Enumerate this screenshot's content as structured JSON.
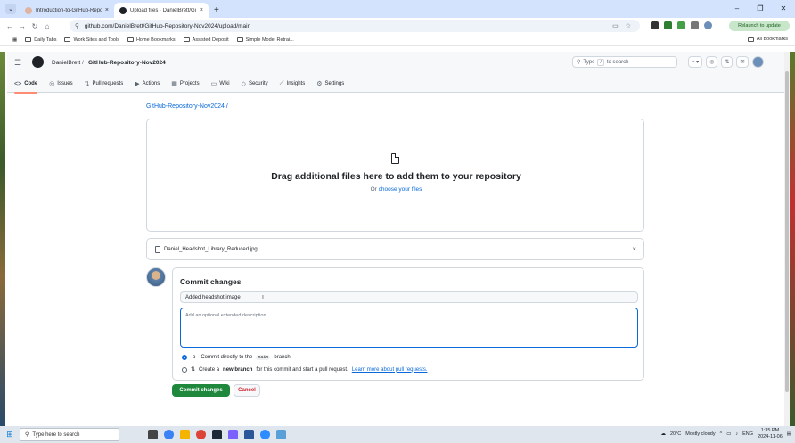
{
  "browser": {
    "tabs": [
      {
        "title": "Introduction-to-GitHub-Reposi"
      },
      {
        "title": "Upload files · DanielBrett/GitH"
      }
    ],
    "address": "github.com/DanielBrett/GitHub-Repository-Nov2024/upload/main",
    "relaunch_label": "Relaunch to update",
    "bookmarks": [
      "Daily Tabs",
      "Work Sites and Tools",
      "Home Bookmarks",
      "Assisted Deposit",
      "Simple Model Retrai..."
    ],
    "all_bookmarks": "All Bookmarks"
  },
  "github": {
    "owner": "DanielBrett",
    "separator": "/",
    "repo": "GitHub-Repository-Nov2024",
    "search_placeholder": "Type",
    "search_key": "/",
    "search_suffix": "to search",
    "plus_label": "+",
    "nav": [
      {
        "label": "Code",
        "icon": "<>"
      },
      {
        "label": "Issues",
        "icon": "◎"
      },
      {
        "label": "Pull requests",
        "icon": "⇅"
      },
      {
        "label": "Actions",
        "icon": "▶"
      },
      {
        "label": "Projects",
        "icon": "▦"
      },
      {
        "label": "Wiki",
        "icon": "▭"
      },
      {
        "label": "Security",
        "icon": "◇"
      },
      {
        "label": "Insights",
        "icon": "⟋"
      },
      {
        "label": "Settings",
        "icon": "⚙"
      }
    ]
  },
  "upload": {
    "repo_crumb": "GitHub-Repository-Nov2024 /",
    "drag_title": "Drag additional files here to add them to your repository",
    "drag_or": "Or",
    "choose_files": "choose your files",
    "file_name": "Daniel_Headshot_Library_Reduced.jpg",
    "remove_icon": "×"
  },
  "commit": {
    "title": "Commit changes",
    "summary_value": "Added headshot image",
    "description_placeholder": "Add an optional extended description...",
    "option_direct_prefix": "Commit directly to the",
    "option_direct_branch": "main",
    "option_direct_suffix": "branch.",
    "option_new_prefix": "Create a",
    "option_new_bold": "new branch",
    "option_new_suffix": "for this commit and start a pull request.",
    "option_new_link": "Learn more about pull requests.",
    "commit_button": "Commit changes",
    "cancel_button": "Cancel"
  },
  "taskbar": {
    "search_placeholder": "Type here to search",
    "temperature": "20°C",
    "weather": "Mostly cloudy",
    "language": "ENG",
    "time": "1:35 PM",
    "date": "2024-11-06"
  },
  "colors": {
    "accent": "#0969da",
    "commit_green": "#1f883d",
    "cancel_red": "#cf222e",
    "nav_underline": "#fd8c73"
  }
}
